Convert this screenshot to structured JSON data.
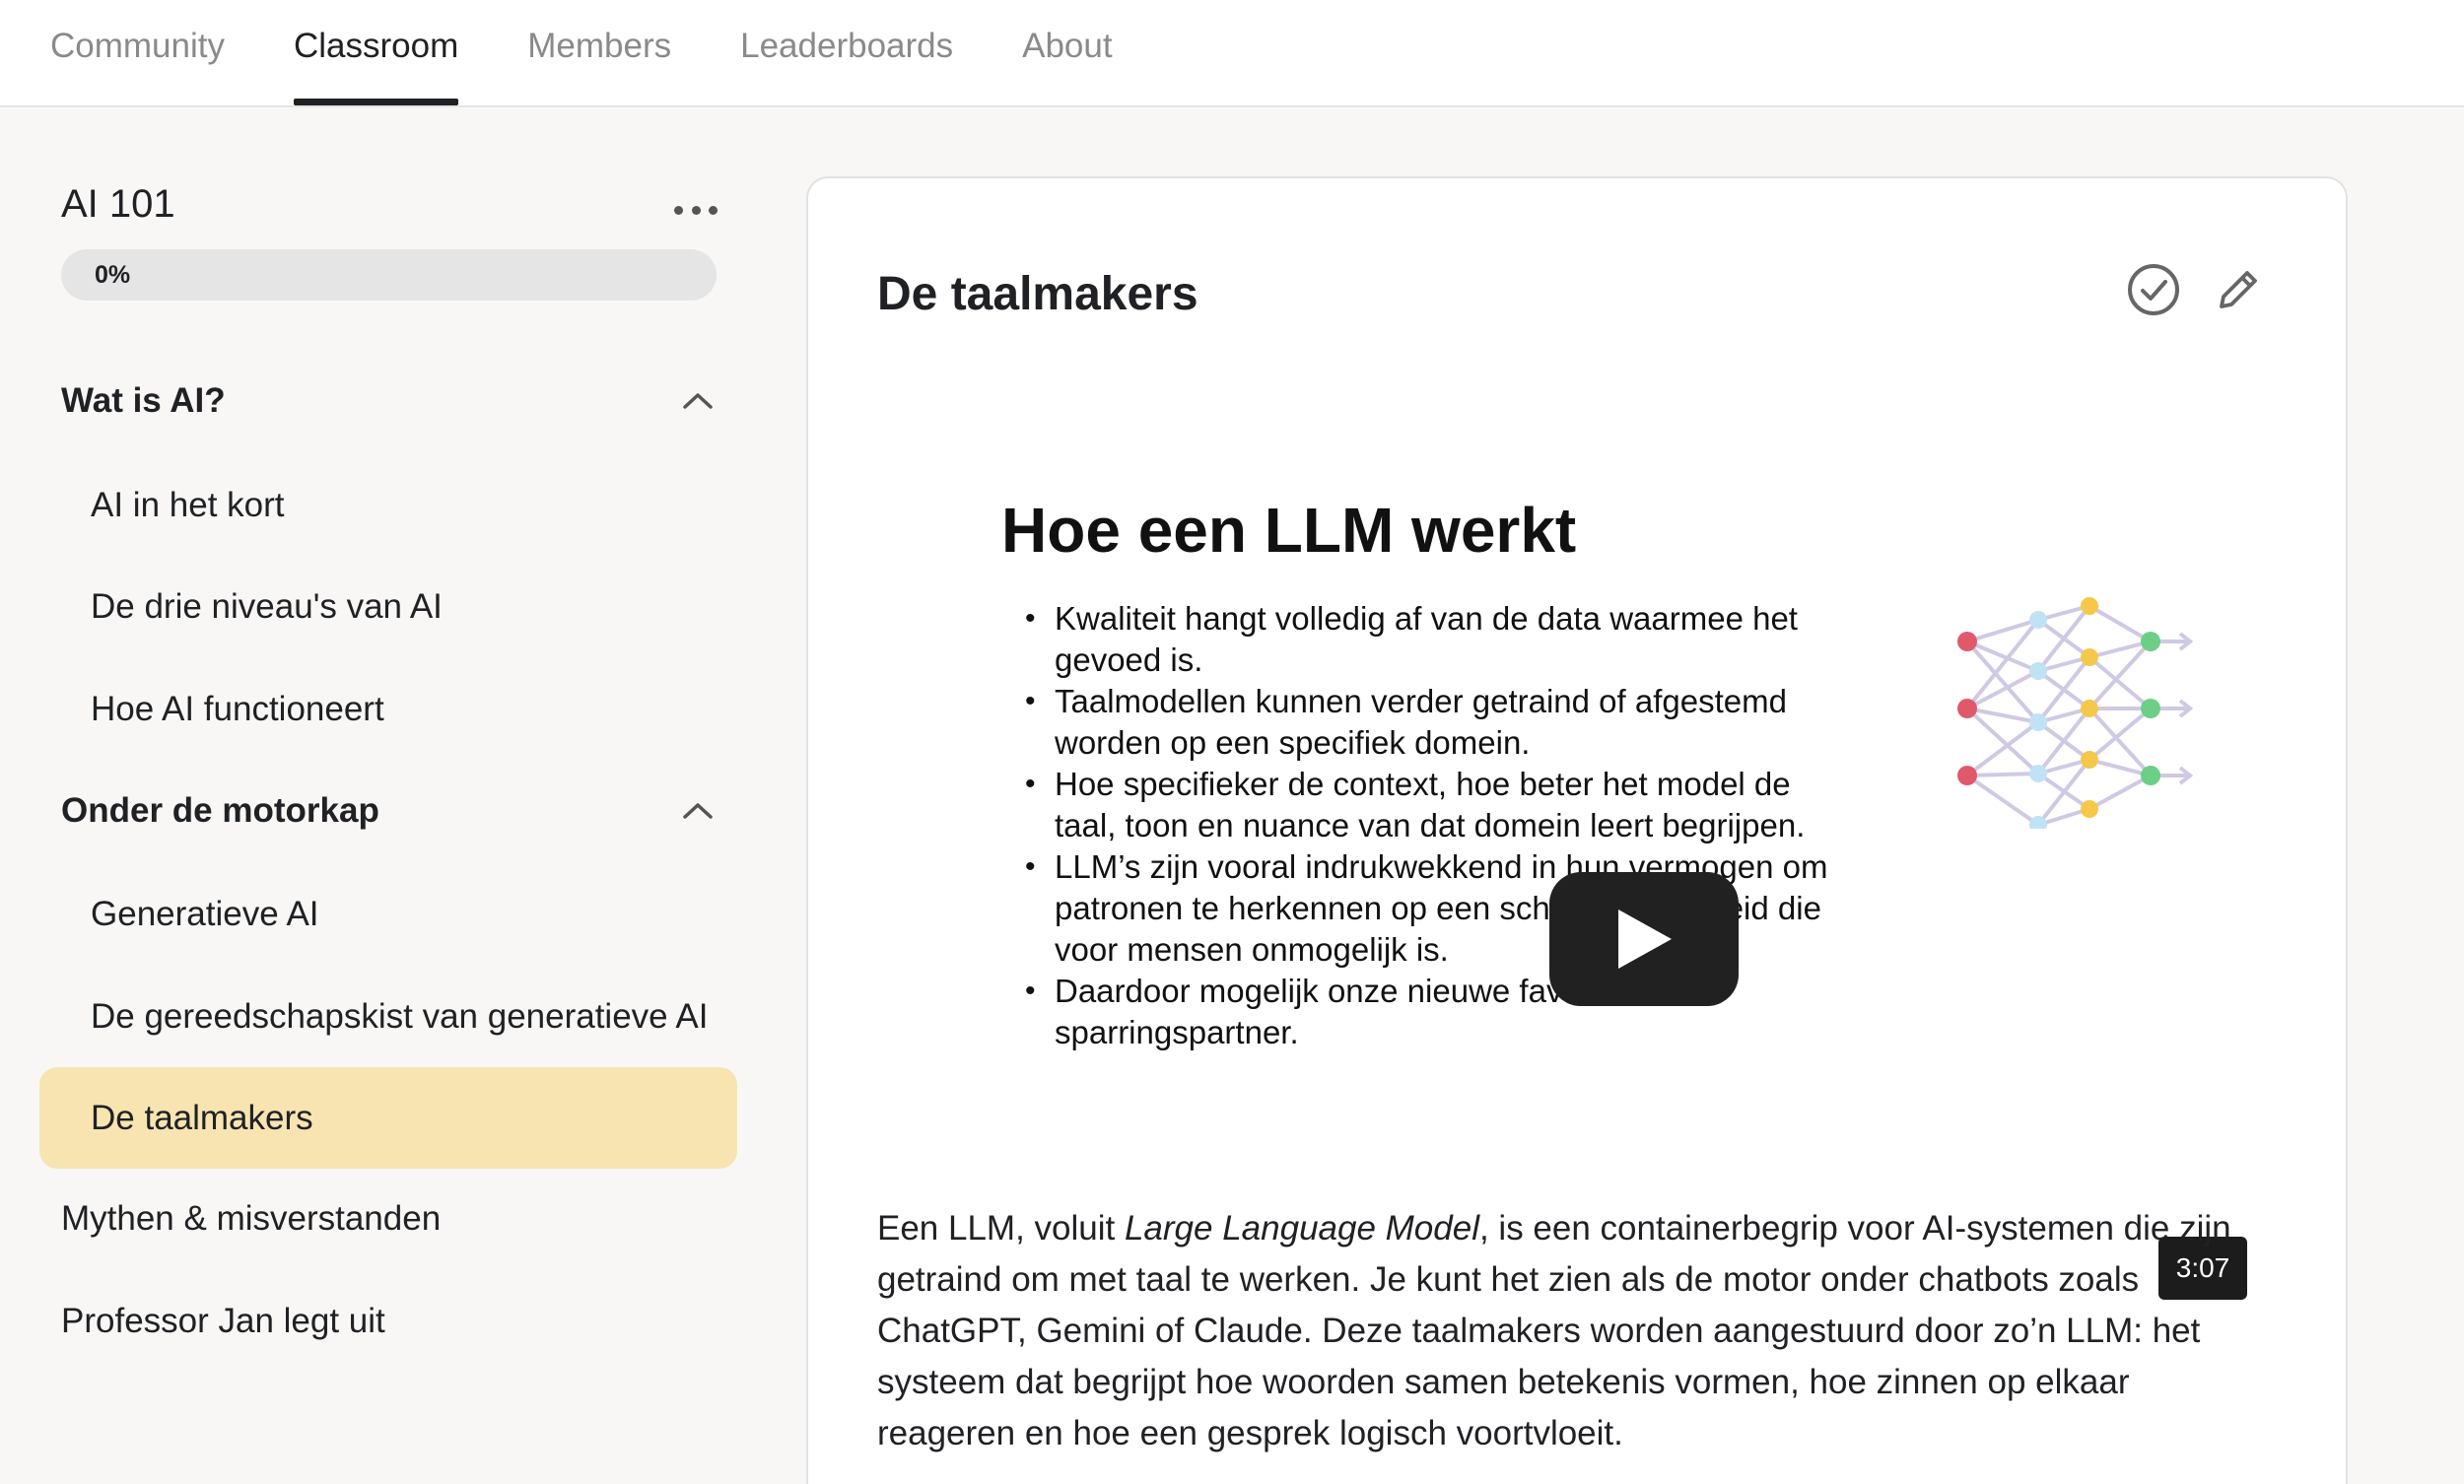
{
  "nav": {
    "tabs": [
      {
        "label": "Community"
      },
      {
        "label": "Classroom",
        "active": true
      },
      {
        "label": "Members"
      },
      {
        "label": "Leaderboards"
      },
      {
        "label": "About"
      }
    ]
  },
  "sidebar": {
    "course_title": "AI 101",
    "more_icon": "more-horizontal-icon",
    "progress": {
      "label": "0%",
      "value": 0
    },
    "sections": [
      {
        "title": "Wat is AI?",
        "expanded": true,
        "lessons": [
          "AI in het kort",
          "De drie niveau's van AI",
          "Hoe AI functioneert"
        ]
      },
      {
        "title": "Onder de motorkap",
        "expanded": true,
        "lessons": [
          "Generatieve AI",
          "De gereedschapskist van generatieve AI",
          "De taalmakers"
        ]
      }
    ],
    "active_lesson": "De taalmakers",
    "active_color": "#f7e4b1",
    "top_level_items": [
      "Mythen & misverstanden",
      "Professor Jan legt uit"
    ]
  },
  "main": {
    "lesson_title": "De taalmakers",
    "icons": {
      "complete": "check-circle-icon",
      "edit": "pencil-icon"
    },
    "video": {
      "slide_title": "Hoe een LLM werkt",
      "bullets": [
        "Kwaliteit hangt volledig af van de data waarmee het gevoed is.",
        "Taalmodellen kunnen verder getraind of afgestemd worden op een specifiek domein.",
        "Hoe specifieker de context, hoe beter het model de taal, toon en nuance van dat domein leert begrijpen.",
        "LLM’s zijn vooral indrukwekkend in hun vermogen om patronen te herkennen op een schaal en snelheid die voor mensen onmogelijk is.",
        "Daardoor mogelijk onze nieuwe favoriete sparringspartner."
      ],
      "duration": "3:07",
      "play_icon": "play-icon",
      "illustration": "neural-network-icon"
    },
    "body": {
      "part1": "Een LLM, voluit ",
      "emphasis": "Large Language Model",
      "part2": ", is een containerbegrip voor AI-systemen die zijn getraind om met taal te werken. Je kunt het zien als de motor onder chatbots zoals ChatGPT, Gemini of Claude. Deze taalmakers worden aangestuurd door zo’n LLM: het systeem dat begrijpt hoe woorden samen betekenis vormen, hoe zinnen op elkaar reageren en hoe een gesprek logisch voortvloeit."
    }
  }
}
